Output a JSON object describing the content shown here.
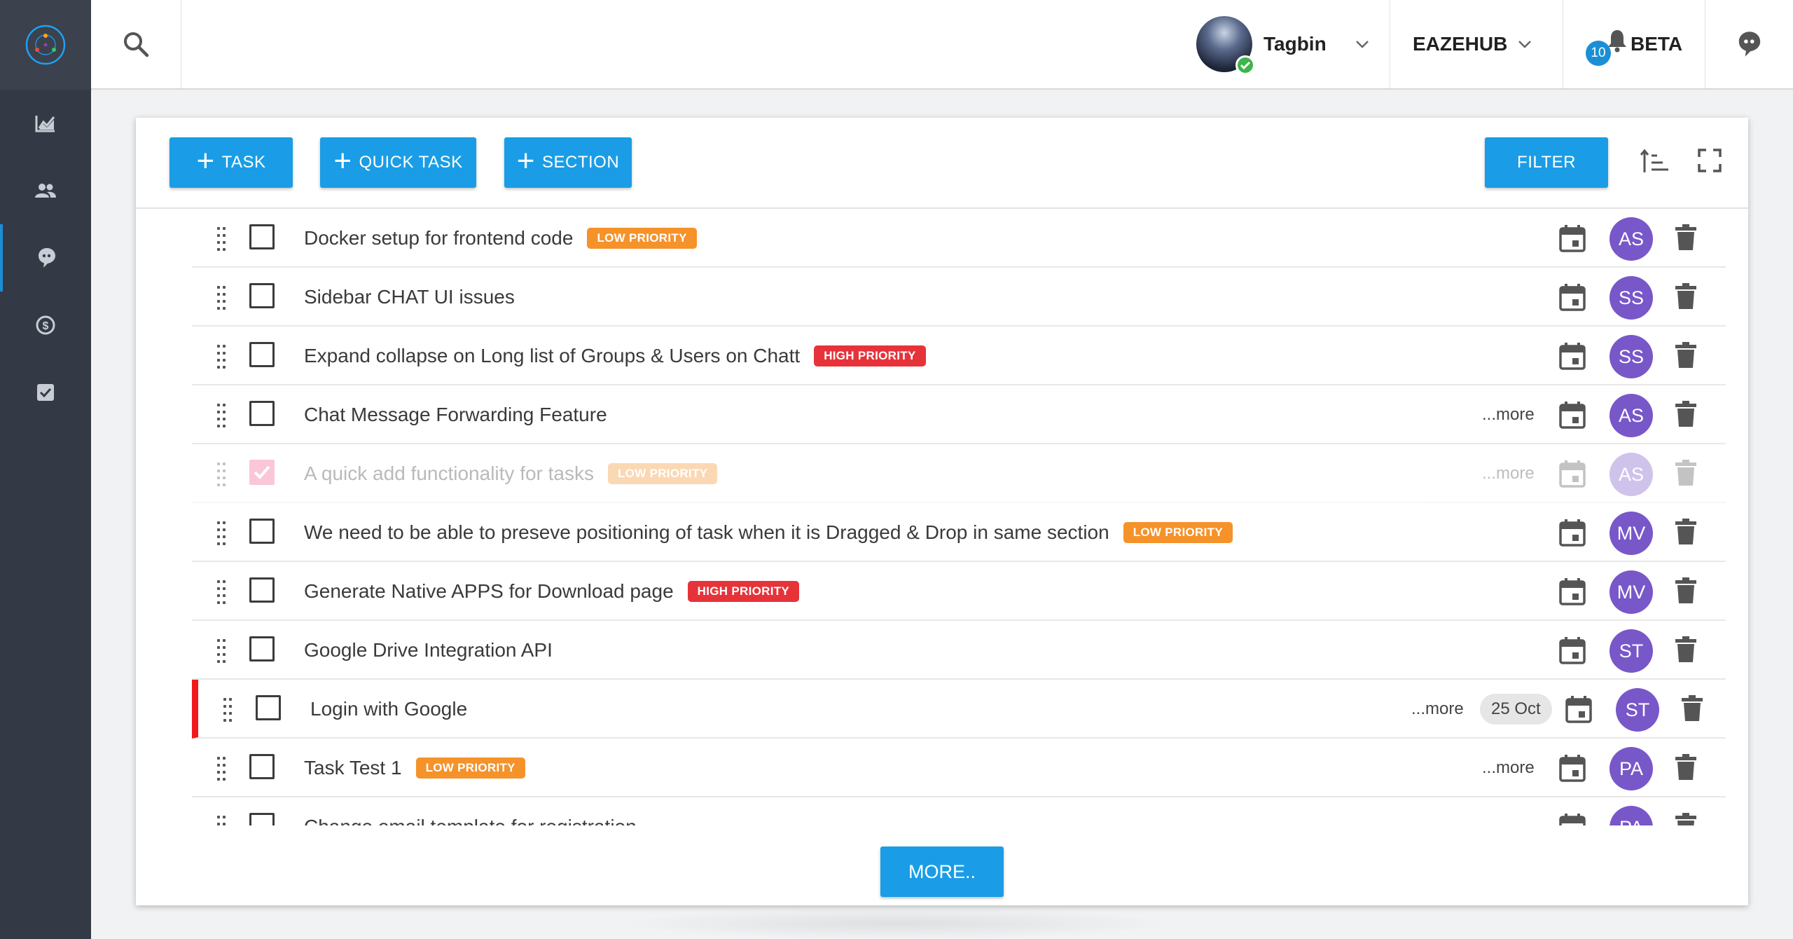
{
  "sidebar": {
    "items": [
      {
        "icon": "analytics-icon"
      },
      {
        "icon": "people-icon"
      },
      {
        "icon": "chat-bubble-icon"
      },
      {
        "icon": "dollar-icon"
      },
      {
        "icon": "checkbox-icon"
      }
    ],
    "active_index": 2
  },
  "topbar": {
    "user_name": "Tagbin",
    "org_name": "EAZEHUB",
    "notification_count": "10",
    "beta_label": "BETA"
  },
  "toolbar": {
    "task_label": "TASK",
    "quick_task_label": "QUICK TASK",
    "section_label": "SECTION",
    "filter_label": "FILTER"
  },
  "tasks": [
    {
      "title": "Docker setup for frontend code",
      "priority": "LOW PRIORITY",
      "priority_level": "low",
      "more": "",
      "date": "",
      "assignee": "AS",
      "checked": false
    },
    {
      "title": "Sidebar CHAT UI issues",
      "priority": "",
      "priority_level": "",
      "more": "",
      "date": "",
      "assignee": "SS",
      "checked": false
    },
    {
      "title": "Expand collapse on Long list of Groups & Users on Chatt",
      "priority": "HIGH PRIORITY",
      "priority_level": "high",
      "more": "",
      "date": "",
      "assignee": "SS",
      "checked": false
    },
    {
      "title": "Chat Message Forwarding Feature",
      "priority": "",
      "priority_level": "",
      "more": "...more",
      "date": "",
      "assignee": "AS",
      "checked": false
    },
    {
      "title": "A quick add functionality for tasks",
      "priority": "LOW PRIORITY",
      "priority_level": "low",
      "more": "...more",
      "date": "",
      "assignee": "AS",
      "checked": true
    },
    {
      "title": "We need to be able to preseve positioning of task when it is Dragged & Drop in same section",
      "priority": "LOW PRIORITY",
      "priority_level": "low",
      "more": "",
      "date": "",
      "assignee": "MV",
      "checked": false
    },
    {
      "title": "Generate Native APPS for Download page",
      "priority": "HIGH PRIORITY",
      "priority_level": "high",
      "more": "",
      "date": "",
      "assignee": "MV",
      "checked": false
    },
    {
      "title": "Google Drive Integration API",
      "priority": "",
      "priority_level": "",
      "more": "",
      "date": "",
      "assignee": "ST",
      "checked": false
    },
    {
      "title": "Login with Google",
      "priority": "",
      "priority_level": "",
      "more": "...more",
      "date": "25 Oct",
      "assignee": "ST",
      "checked": false,
      "flagged": true
    },
    {
      "title": "Task Test 1",
      "priority": "LOW PRIORITY",
      "priority_level": "low",
      "more": "...more",
      "date": "",
      "assignee": "PA",
      "checked": false
    },
    {
      "title": "Change email template for registration",
      "priority": "",
      "priority_level": "",
      "more": "",
      "date": "",
      "assignee": "PA",
      "checked": false
    }
  ],
  "more_button_label": "MORE..",
  "colors": {
    "sidebar": "#343a45",
    "primary": "#1a9de6",
    "low_priority": "#f5922a",
    "high_priority": "#e6333a",
    "avatar": "#7857c9",
    "flag": "#f01a1a"
  }
}
